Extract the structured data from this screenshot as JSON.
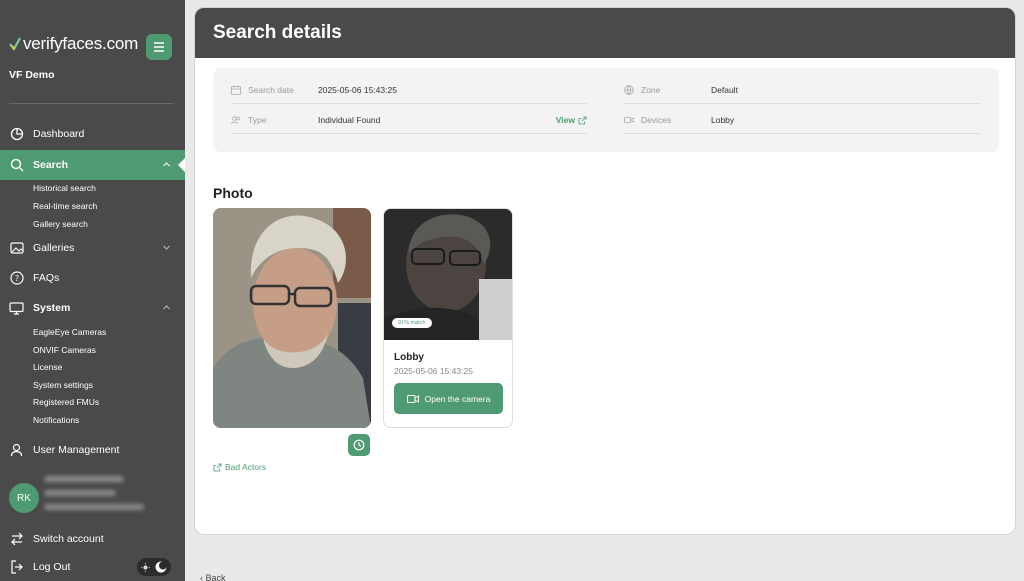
{
  "brand": {
    "name": "verifyfaces.com",
    "accent": "#4f9a73"
  },
  "org_name": "VF Demo",
  "nav": {
    "dashboard": "Dashboard",
    "search": "Search",
    "search_sub": [
      "Historical search",
      "Real-time search",
      "Gallery search"
    ],
    "galleries": "Galleries",
    "faqs": "FAQs",
    "system": "System",
    "system_sub": [
      "EagleEye Cameras",
      "ONVIF Cameras",
      "License",
      "System settings",
      "Registered FMUs",
      "Notifications"
    ],
    "user_management": "User Management"
  },
  "user": {
    "initials": "RK"
  },
  "footer": {
    "switch_account": "Switch account",
    "logout": "Log Out"
  },
  "page": {
    "title": "Search details",
    "fields": {
      "search_date_label": "Search date",
      "search_date_value": "2025-05-06 15:43:25",
      "type_label": "Type",
      "type_value": "Individual Found",
      "view_link": "View",
      "zone_label": "Zone",
      "zone_value": "Default",
      "devices_label": "Devices",
      "devices_value": "Lobby"
    },
    "photo_section_title": "Photo",
    "bad_actors_link": "Bad Actors",
    "match": {
      "badge": "91% match",
      "location": "Lobby",
      "timestamp": "2025-05-06 15:43:25",
      "open_camera_label": "Open the camera"
    },
    "back_label": "Back"
  }
}
